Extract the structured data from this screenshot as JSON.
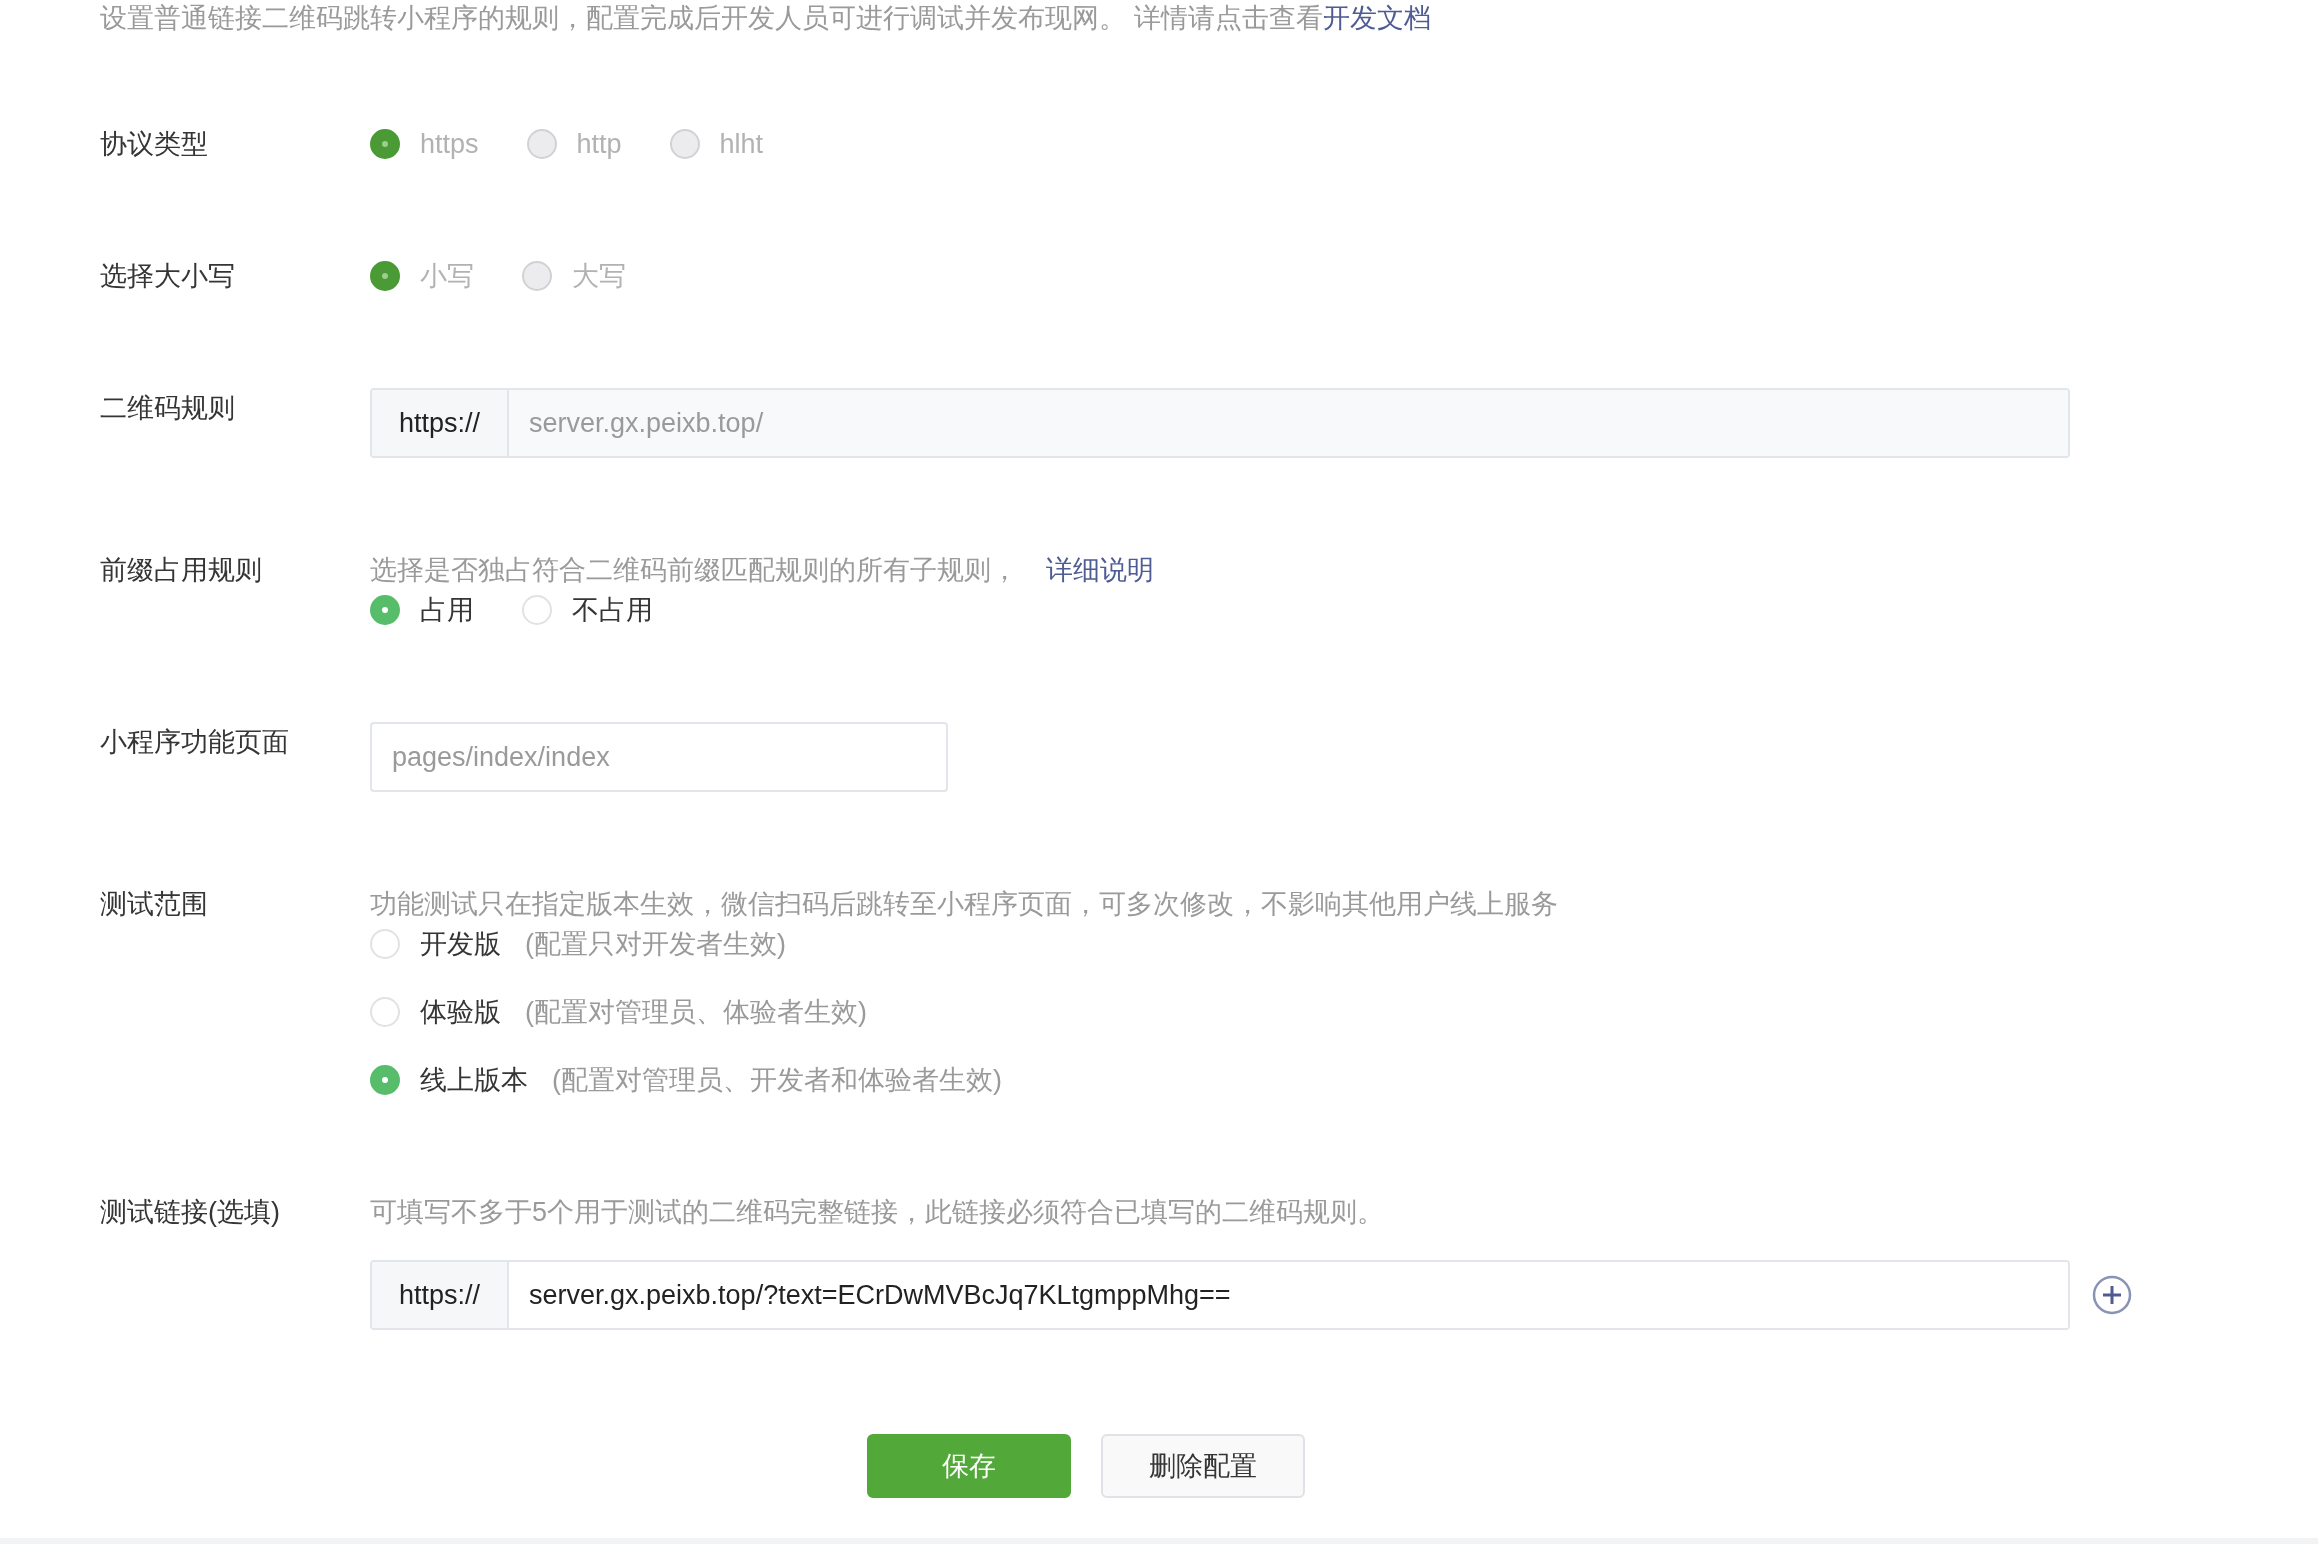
{
  "intro": {
    "text": "设置普通链接二维码跳转小程序的规则，配置完成后开发人员可进行调试并发布现网。 详情请点击查看",
    "link": "开发文档"
  },
  "fields": [
    {
      "kind": "radio",
      "label": "协议类型",
      "disabled": true,
      "options": [
        {
          "label": "https",
          "selected": true
        },
        {
          "label": "http",
          "selected": false
        },
        {
          "label": "hlht",
          "selected": false
        }
      ]
    },
    {
      "kind": "radio",
      "label": "选择大小写",
      "disabled": true,
      "options": [
        {
          "label": "小写",
          "selected": true
        },
        {
          "label": "大写",
          "selected": false
        }
      ]
    },
    {
      "kind": "prefixed_input",
      "label": "二维码规则",
      "disabled": true,
      "prefix": "https://",
      "value": "server.gx.peixb.top/"
    },
    {
      "kind": "radio",
      "label": "前缀占用规则",
      "description": "选择是否独占符合二维码前缀匹配规则的所有子规则，",
      "link": "详细说明",
      "disabled": false,
      "options": [
        {
          "label": "占用",
          "selected": true
        },
        {
          "label": "不占用",
          "selected": false
        }
      ]
    },
    {
      "kind": "input",
      "label": "小程序功能页面",
      "placeholder": "pages/index/index"
    },
    {
      "kind": "radio",
      "label": "测试范围",
      "description": "功能测试只在指定版本生效，微信扫码后跳转至小程序页面，可多次修改，不影响其他用户线上服务",
      "disabled": false,
      "stacked": true,
      "options": [
        {
          "label": "开发版",
          "note": "(配置只对开发者生效)",
          "selected": false
        },
        {
          "label": "体验版",
          "note": "(配置对管理员、体验者生效)",
          "selected": false
        },
        {
          "label": "线上版本",
          "note": "(配置对管理员、开发者和体验者生效)",
          "selected": true
        }
      ]
    },
    {
      "kind": "prefixed_input",
      "label": "测试链接(选填)",
      "description": "可填写不多于5个用于测试的二维码完整链接，此链接必须符合已填写的二维码规则。",
      "disabled": false,
      "prefix": "https://",
      "value": "server.gx.peixb.top/?text=ECrDwMVBcJq7KLtgmppMhg==",
      "add_button": true
    }
  ],
  "buttons": [
    {
      "label": "保存",
      "kind": "primary"
    },
    {
      "label": "删除配置",
      "kind": "default"
    }
  ]
}
